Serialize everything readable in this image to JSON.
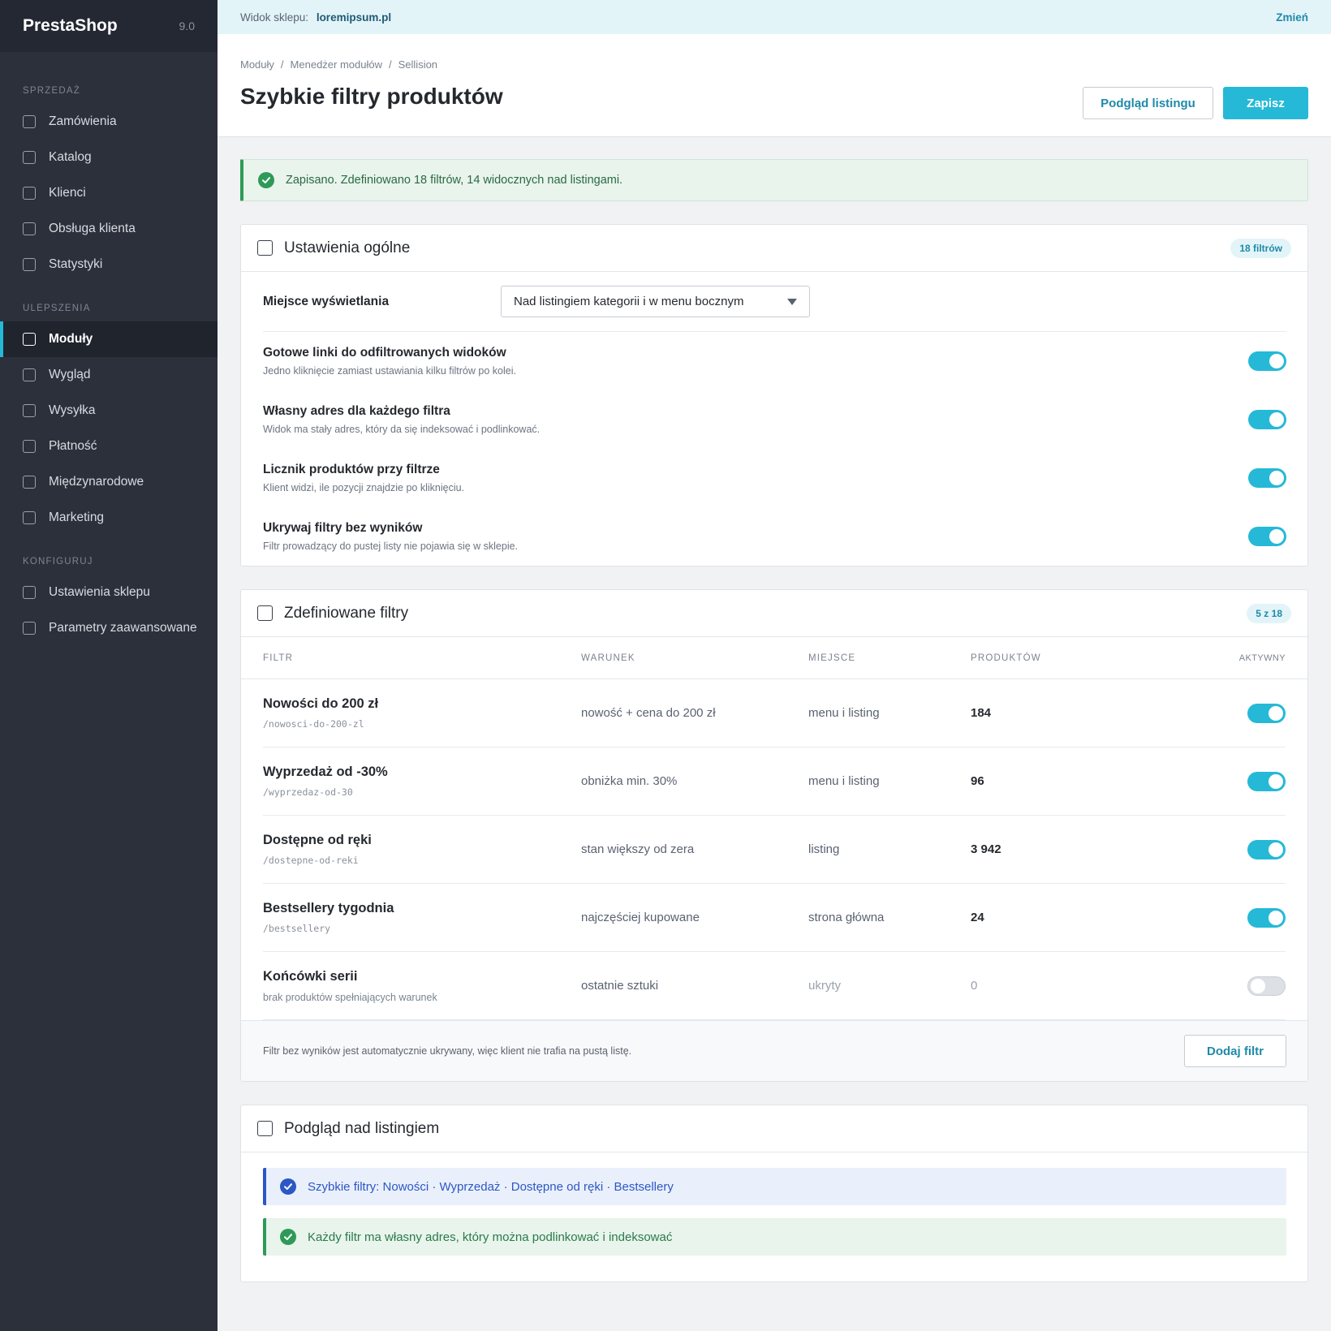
{
  "sidebar": {
    "brand": "PrestaShop",
    "version": "9.0",
    "sections": [
      {
        "title": "SPRZEDAŻ",
        "items": [
          "Zamówienia",
          "Katalog",
          "Klienci",
          "Obsługa klienta",
          "Statystyki"
        ]
      },
      {
        "title": "ULEPSZENIA",
        "items": [
          "Moduły",
          "Wygląd",
          "Wysyłka",
          "Płatność",
          "Międzynarodowe",
          "Marketing"
        ]
      },
      {
        "title": "KONFIGURUJ",
        "items": [
          "Ustawienia sklepu",
          "Parametry zaawansowane"
        ]
      }
    ],
    "active_item": "Moduły"
  },
  "topbar": {
    "shop_label": "Widok sklepu:",
    "shop_url": "loremipsum.pl",
    "change_label": "Zmień"
  },
  "header": {
    "breadcrumb": [
      "Moduły",
      "/",
      "Menedżer modułów",
      "/",
      "Sellision"
    ],
    "title": "Szybkie filtry produktów",
    "preview_button": "Podgląd listingu",
    "save_button": "Zapisz"
  },
  "alert_top": "Zapisano. Zdefiniowano 18 filtrów, 14 widocznych nad listingami.",
  "general": {
    "title": "Ustawienia ogólne",
    "badge": "18 filtrów",
    "display_label": "Miejsce wyświetlania",
    "display_value": "Nad listingiem kategorii i w menu bocznym",
    "toggles": [
      {
        "title": "Gotowe linki do odfiltrowanych widoków",
        "desc": "Jedno kliknięcie zamiast ustawiania kilku filtrów po kolei.",
        "on": true
      },
      {
        "title": "Własny adres dla każdego filtra",
        "desc": "Widok ma stały adres, który da się indeksować i podlinkować.",
        "on": true
      },
      {
        "title": "Licznik produktów przy filtrze",
        "desc": "Klient widzi, ile pozycji znajdzie po kliknięciu.",
        "on": true
      },
      {
        "title": "Ukrywaj filtry bez wyników",
        "desc": "Filtr prowadzący do pustej listy nie pojawia się w sklepie.",
        "on": true
      }
    ]
  },
  "filters": {
    "title": "Zdefiniowane filtry",
    "badge": "5 z 18",
    "columns": {
      "filter": "FILTR",
      "condition": "WARUNEK",
      "place": "MIEJSCE",
      "count": "PRODUKTÓW",
      "active": "AKTYWNY"
    },
    "rows": [
      {
        "name": "Nowości do 200 zł",
        "sub": "/nowosci-do-200-zl",
        "condition": "nowość + cena do 200 zł",
        "place": "menu i listing",
        "count": "184",
        "active": true
      },
      {
        "name": "Wyprzedaż od -30%",
        "sub": "/wyprzedaz-od-30",
        "condition": "obniżka min. 30%",
        "place": "menu i listing",
        "count": "96",
        "active": true
      },
      {
        "name": "Dostępne od ręki",
        "sub": "/dostepne-od-reki",
        "condition": "stan większy od zera",
        "place": "listing",
        "count": "3 942",
        "active": true
      },
      {
        "name": "Bestsellery tygodnia",
        "sub": "/bestsellery",
        "condition": "najczęściej kupowane",
        "place": "strona główna",
        "count": "24",
        "active": true
      },
      {
        "name": "Końcówki serii",
        "sub": "brak produktów spełniających warunek",
        "condition": "ostatnie sztuki",
        "place": "ukryty",
        "count": "0",
        "active": false
      }
    ],
    "footer_note": "Filtr bez wyników jest automatycznie ukrywany, więc klient nie trafia na pustą listę.",
    "add_button": "Dodaj filtr"
  },
  "preview": {
    "title": "Podgląd nad listingiem",
    "info_alert": "Szybkie filtry: Nowości · Wyprzedaż · Dostępne od ręki · Bestsellery",
    "ok_alert": "Każdy filtr ma własny adres, który można podlinkować i indeksować"
  },
  "colors": {
    "accent": "#25b9d7",
    "sidebar_bg": "#2b303b",
    "success": "#2e9a57",
    "info": "#2c57c4"
  },
  "icons": {
    "alert": "check-circle-icon",
    "sections": "checkbox-icon",
    "select": "caret-down-icon"
  }
}
